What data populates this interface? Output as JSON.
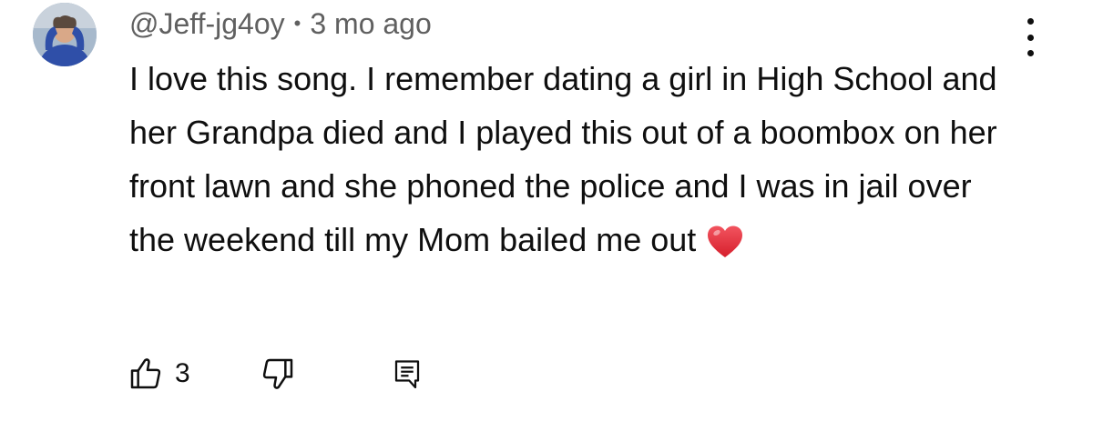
{
  "comment": {
    "author": "@Jeff-jg4oy",
    "separator": "•",
    "timestamp": "3 mo ago",
    "text": "I love this song. I remember dating a girl in High School and her Grandpa died and I played this out of a boombox on her front lawn and she phoned the police and I was in jail over the weekend till my Mom bailed me out",
    "emoji": "red-heart",
    "like_count": "3"
  },
  "icons": {
    "like": "thumbs-up-icon",
    "dislike": "thumbs-down-icon",
    "reply": "comment-reply-icon",
    "menu": "more-vertical-icon"
  },
  "colors": {
    "meta_text": "#606060",
    "body_text": "#0f0f0f",
    "heart": "#e8303f"
  }
}
